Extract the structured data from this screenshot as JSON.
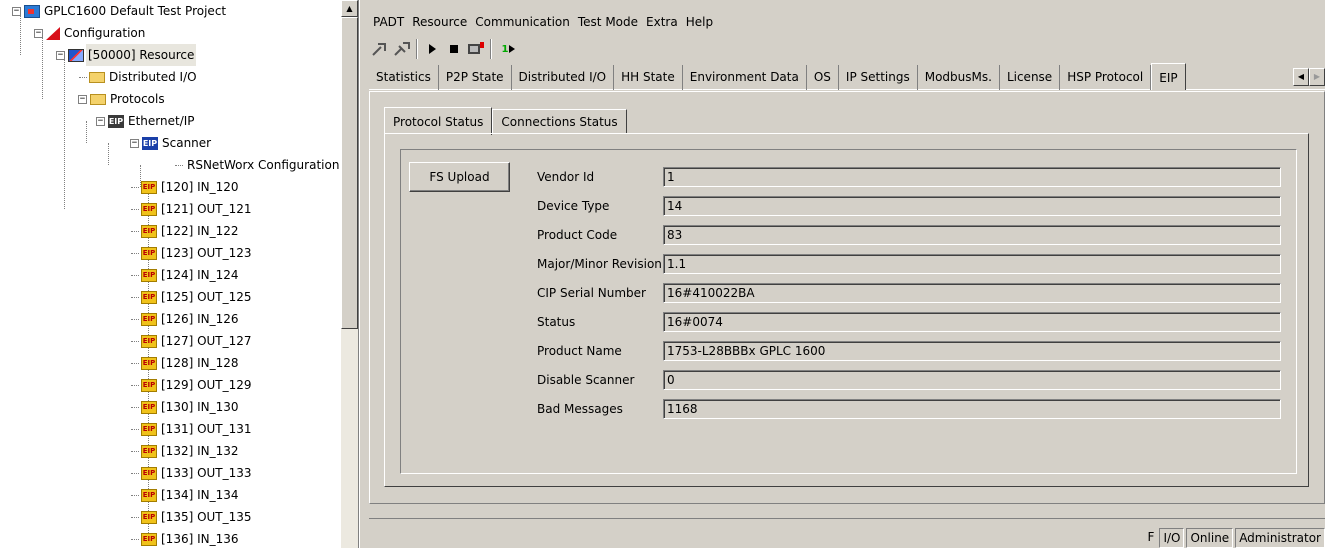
{
  "tree": {
    "items": [
      {
        "label": "GPLC1600 Default Test Project",
        "icon": "project-icon",
        "level": 0,
        "expander": "-"
      },
      {
        "label": "Configuration",
        "icon": "configuration-icon",
        "level": 1,
        "expander": "-"
      },
      {
        "label": "[50000] Resource",
        "icon": "resource-icon",
        "level": 2,
        "expander": "-",
        "selected": true
      },
      {
        "label": "Distributed I/O",
        "icon": "folder-icon",
        "level": 3
      },
      {
        "label": "Protocols",
        "icon": "folder-icon",
        "level": 3,
        "expander": "-"
      },
      {
        "label": "Ethernet/IP",
        "icon": "eip-icon",
        "level": 4,
        "expander": "-"
      },
      {
        "label": "Scanner",
        "icon": "eip-scanner-icon",
        "level": 5,
        "expander": "-"
      },
      {
        "label": "RSNetWorx Configuration",
        "icon": "",
        "level": 6
      },
      {
        "label": "[120] IN_120",
        "icon": "eip-io-icon",
        "level": 5
      },
      {
        "label": "[121] OUT_121",
        "icon": "eip-io-icon",
        "level": 5
      },
      {
        "label": "[122] IN_122",
        "icon": "eip-io-icon",
        "level": 5
      },
      {
        "label": "[123] OUT_123",
        "icon": "eip-io-icon",
        "level": 5
      },
      {
        "label": "[124] IN_124",
        "icon": "eip-io-icon",
        "level": 5
      },
      {
        "label": "[125] OUT_125",
        "icon": "eip-io-icon",
        "level": 5
      },
      {
        "label": "[126] IN_126",
        "icon": "eip-io-icon",
        "level": 5
      },
      {
        "label": "[127] OUT_127",
        "icon": "eip-io-icon",
        "level": 5
      },
      {
        "label": "[128] IN_128",
        "icon": "eip-io-icon",
        "level": 5
      },
      {
        "label": "[129] OUT_129",
        "icon": "eip-io-icon",
        "level": 5
      },
      {
        "label": "[130] IN_130",
        "icon": "eip-io-icon",
        "level": 5
      },
      {
        "label": "[131] OUT_131",
        "icon": "eip-io-icon",
        "level": 5
      },
      {
        "label": "[132] IN_132",
        "icon": "eip-io-icon",
        "level": 5
      },
      {
        "label": "[133] OUT_133",
        "icon": "eip-io-icon",
        "level": 5
      },
      {
        "label": "[134] IN_134",
        "icon": "eip-io-icon",
        "level": 5
      },
      {
        "label": "[135] OUT_135",
        "icon": "eip-io-icon",
        "level": 5
      },
      {
        "label": "[136] IN_136",
        "icon": "eip-io-icon",
        "level": 5
      }
    ]
  },
  "menu": [
    "PADT",
    "Resource",
    "Communication",
    "Test Mode",
    "Extra",
    "Help"
  ],
  "toolbar": {
    "icons": [
      "connect-icon",
      "disconnect-icon",
      "run-icon",
      "stop-icon",
      "download-icon",
      "step-icon"
    ],
    "step_label": "1"
  },
  "tabs": [
    "Statistics",
    "P2P State",
    "Distributed I/O",
    "HH State",
    "Environment Data",
    "OS",
    "IP Settings",
    "ModbusMs.",
    "License",
    "HSP Protocol",
    "EIP"
  ],
  "active_tab": "EIP",
  "subtabs": [
    "Protocol Status",
    "Connections Status"
  ],
  "active_subtab": "Protocol Status",
  "upload_button": "FS Upload",
  "fields": [
    {
      "label": "Vendor Id",
      "value": "1"
    },
    {
      "label": "Device Type",
      "value": "14"
    },
    {
      "label": "Product Code",
      "value": "83"
    },
    {
      "label": "Major/Minor Revision",
      "value": "1.1"
    },
    {
      "label": "CIP Serial Number",
      "value": "16#410022BA"
    },
    {
      "label": "Status",
      "value": "16#0074"
    },
    {
      "label": "Product Name",
      "value": "1753-L28BBBx GPLC 1600"
    },
    {
      "label": "Disable Scanner",
      "value": "0"
    },
    {
      "label": "Bad Messages",
      "value": "1168"
    }
  ],
  "status": {
    "force": "F",
    "io": "I/O",
    "connection": "Online",
    "user": "Administrator"
  }
}
